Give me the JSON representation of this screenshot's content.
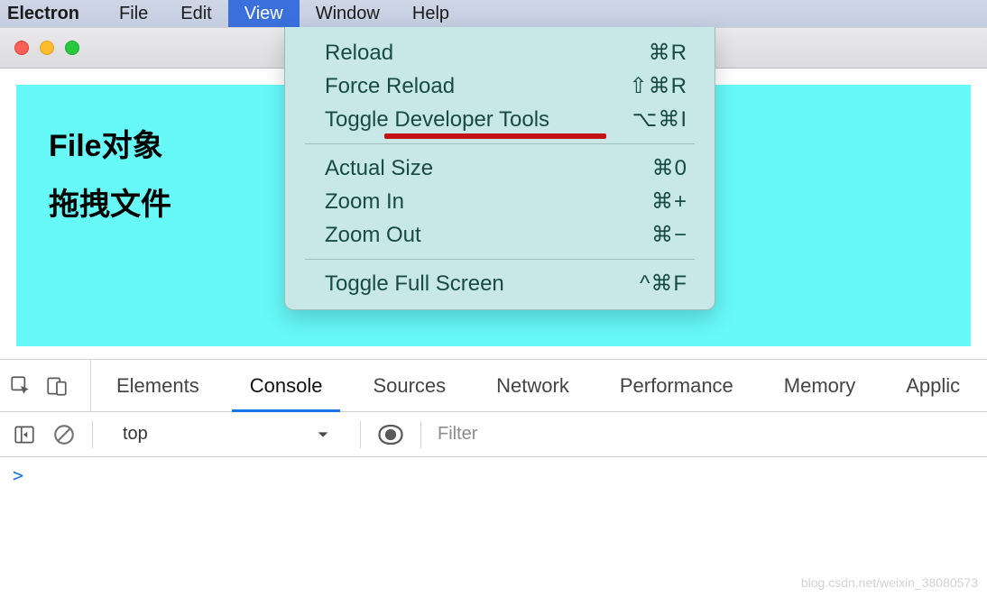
{
  "menubar": {
    "app": "Electron",
    "items": [
      "File",
      "Edit",
      "View",
      "Window",
      "Help"
    ],
    "active_index": 2
  },
  "view_menu": {
    "group1": [
      {
        "label": "Reload",
        "shortcut": "⌘R"
      },
      {
        "label": "Force Reload",
        "shortcut": "⇧⌘R"
      },
      {
        "label": "Toggle Developer Tools",
        "shortcut": "⌥⌘I",
        "highlight": true
      }
    ],
    "group2": [
      {
        "label": "Actual Size",
        "shortcut": "⌘0"
      },
      {
        "label": "Zoom In",
        "shortcut": "⌘+"
      },
      {
        "label": "Zoom Out",
        "shortcut": "⌘−"
      }
    ],
    "group3": [
      {
        "label": "Toggle Full Screen",
        "shortcut": "^⌘F"
      }
    ]
  },
  "page": {
    "heading1": "File对象",
    "heading2": "拖拽文件"
  },
  "devtools": {
    "tabs": [
      "Elements",
      "Console",
      "Sources",
      "Network",
      "Performance",
      "Memory",
      "Applic"
    ],
    "active_tab_index": 1,
    "context": "top",
    "filter_placeholder": "Filter",
    "console_prompt": ">"
  },
  "watermark": "blog.csdn.net/weixin_38080573"
}
